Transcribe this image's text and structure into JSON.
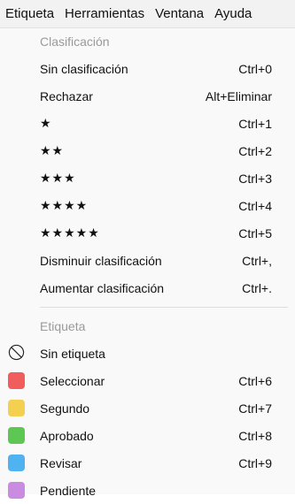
{
  "menubar": {
    "items": [
      {
        "label": "Etiqueta"
      },
      {
        "label": "Herramientas"
      },
      {
        "label": "Ventana"
      },
      {
        "label": "Ayuda"
      }
    ]
  },
  "rating_section": {
    "header": "Clasificación",
    "items": [
      {
        "label": "Sin clasificación",
        "shortcut": "Ctrl+0"
      },
      {
        "label": "Rechazar",
        "shortcut": "Alt+Eliminar"
      },
      {
        "label": "★",
        "shortcut": "Ctrl+1"
      },
      {
        "label": "★★",
        "shortcut": "Ctrl+2"
      },
      {
        "label": "★★★",
        "shortcut": "Ctrl+3"
      },
      {
        "label": "★★★★",
        "shortcut": "Ctrl+4"
      },
      {
        "label": "★★★★★",
        "shortcut": "Ctrl+5"
      },
      {
        "label": "Disminuir clasificación",
        "shortcut": "Ctrl+,"
      },
      {
        "label": "Aumentar clasificación",
        "shortcut": "Ctrl+."
      }
    ]
  },
  "label_section": {
    "header": "Etiqueta",
    "items": [
      {
        "label": "Sin etiqueta",
        "shortcut": "",
        "icon": "no-label-icon"
      },
      {
        "label": "Seleccionar",
        "shortcut": "Ctrl+6",
        "color": "#f15c5c"
      },
      {
        "label": "Segundo",
        "shortcut": "Ctrl+7",
        "color": "#f3d050"
      },
      {
        "label": "Aprobado",
        "shortcut": "Ctrl+8",
        "color": "#5ec653"
      },
      {
        "label": "Revisar",
        "shortcut": "Ctrl+9",
        "color": "#4eb3f0"
      },
      {
        "label": "Pendiente",
        "shortcut": "",
        "color": "#c98ce0"
      }
    ]
  }
}
